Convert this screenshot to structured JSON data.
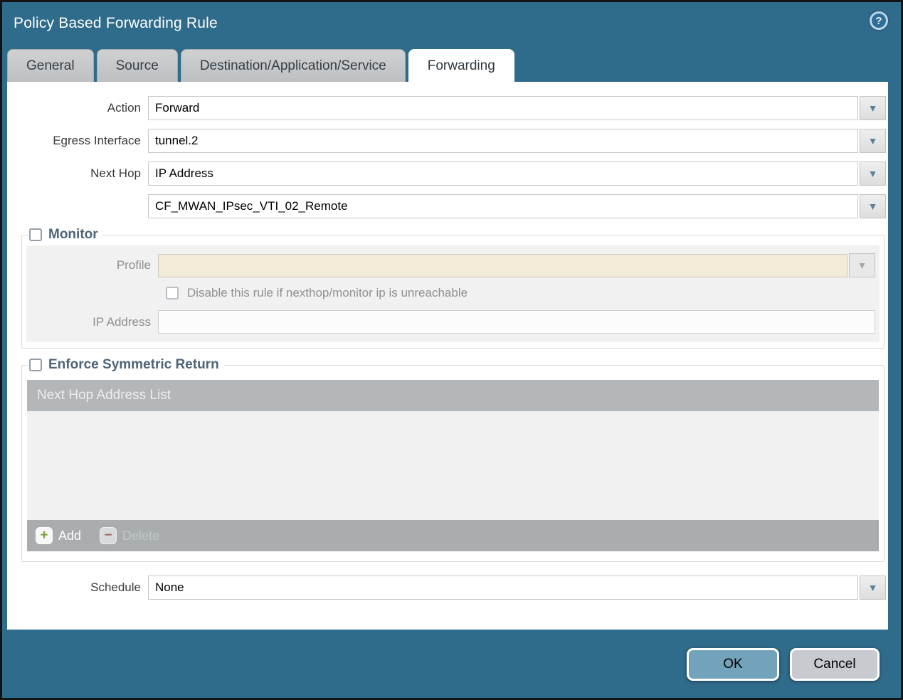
{
  "window": {
    "title": "Policy Based Forwarding Rule"
  },
  "icons": {
    "help": "?",
    "dropdown": "▼",
    "plus": "+",
    "minus": "−"
  },
  "tabs": [
    {
      "label": "General"
    },
    {
      "label": "Source"
    },
    {
      "label": "Destination/Application/Service"
    },
    {
      "label": "Forwarding"
    }
  ],
  "form": {
    "action_label": "Action",
    "action_value": "Forward",
    "egress_label": "Egress Interface",
    "egress_value": "tunnel.2",
    "next_hop_label": "Next Hop",
    "next_hop_value": "IP Address",
    "next_hop_address_value": "CF_MWAN_IPsec_VTI_02_Remote",
    "schedule_label": "Schedule",
    "schedule_value": "None"
  },
  "monitor": {
    "title": "Monitor",
    "checked": false,
    "profile_label": "Profile",
    "profile_value": "",
    "disable_rule_label": "Disable this rule if nexthop/monitor ip is unreachable",
    "disable_rule_checked": false,
    "ip_address_label": "IP Address",
    "ip_address_value": ""
  },
  "enforce": {
    "title": "Enforce Symmetric Return",
    "checked": false,
    "list_header": "Next Hop Address List",
    "add_label": "Add",
    "delete_label": "Delete"
  },
  "buttons": {
    "ok": "OK",
    "cancel": "Cancel"
  },
  "colors": {
    "accent_teal": "#2f6b8a",
    "ok_button": "#73a3bb",
    "tab_gray": "#c5c6c7",
    "profile_disabled_bg": "#f2ebd8",
    "table_header_gray": "#b4b7ba"
  }
}
